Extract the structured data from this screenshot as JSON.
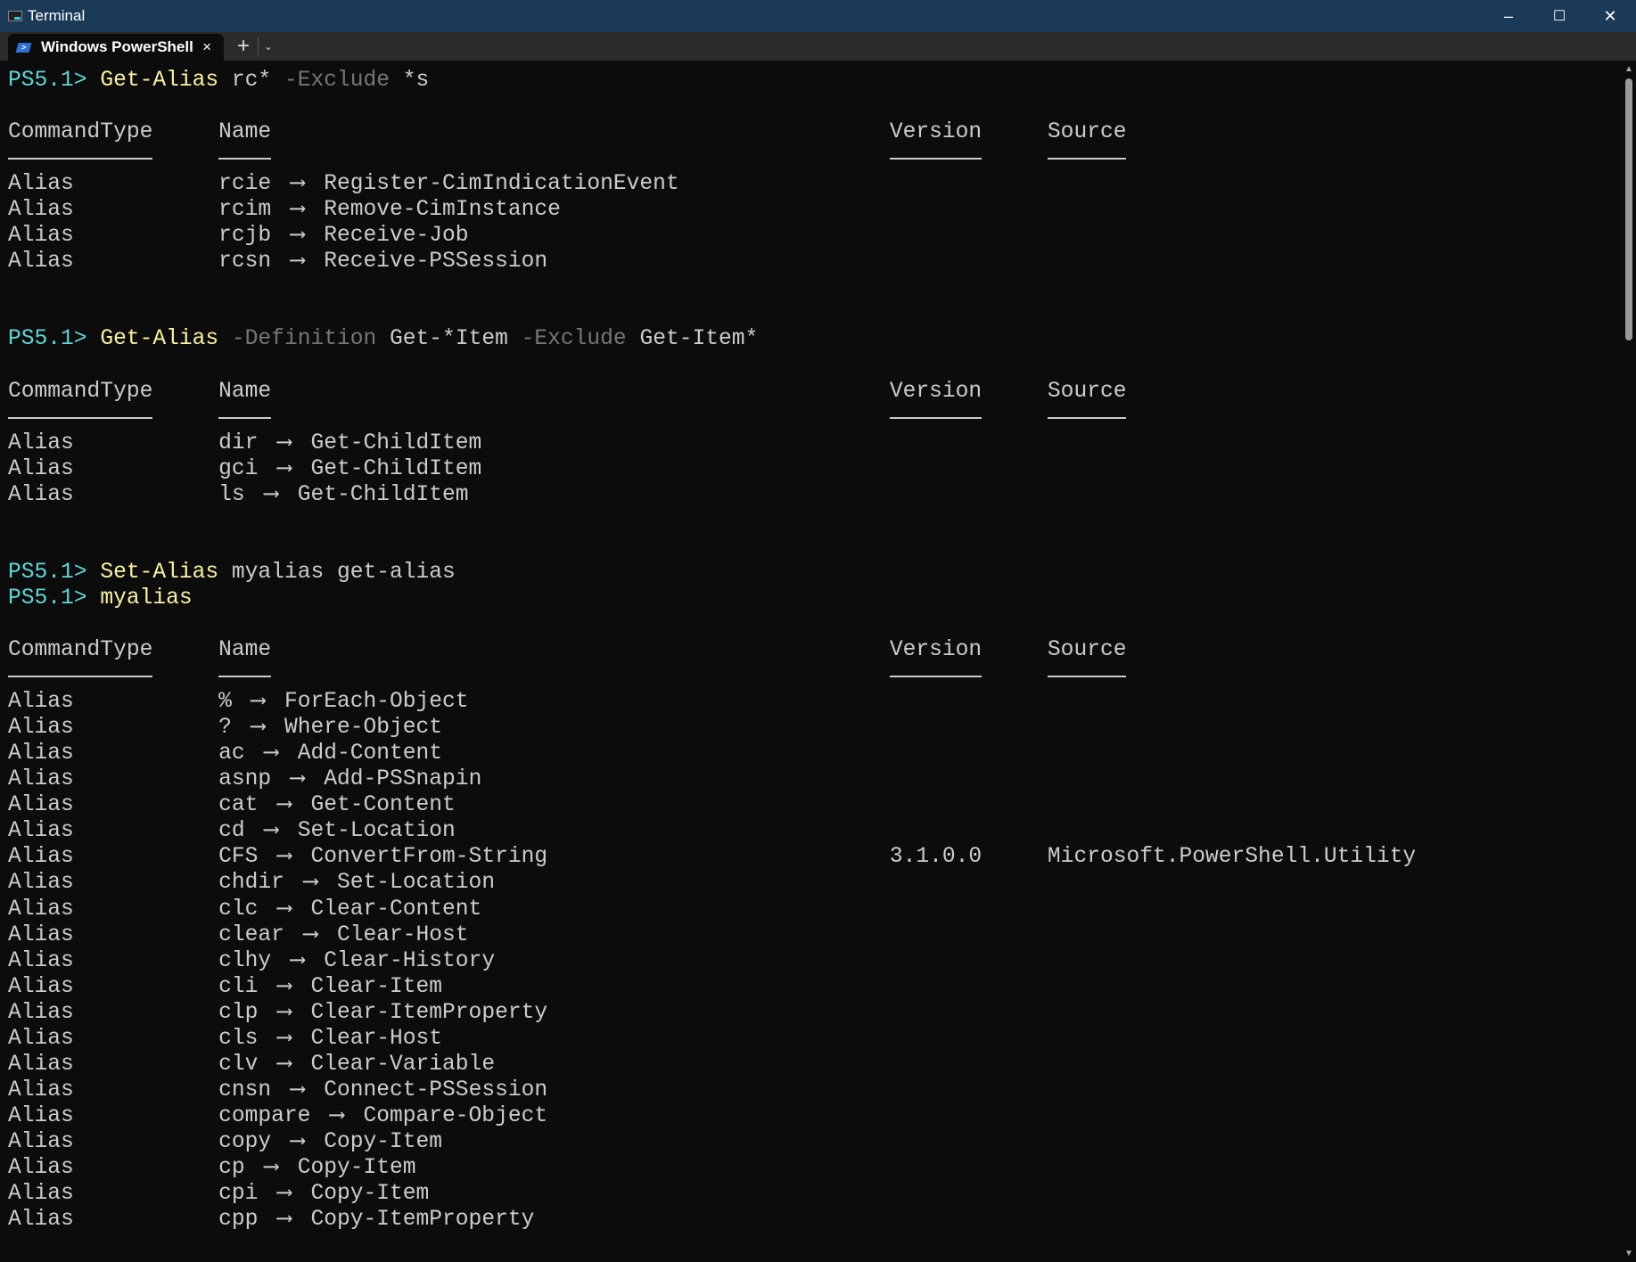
{
  "window": {
    "title": "Terminal",
    "minimize": "–",
    "maximize": "☐",
    "close": "✕"
  },
  "tabs": [
    {
      "label": "Windows PowerShell",
      "close": "×"
    }
  ],
  "new_tab": "+",
  "dropdown": "⌄",
  "prompt": "PS5.1> ",
  "headers": {
    "type": "CommandType",
    "name": "Name",
    "version": "Version",
    "source": "Source"
  },
  "blocks": [
    {
      "commands": [
        {
          "tokens": [
            {
              "t": "Get-Alias",
              "k": "cmd"
            },
            {
              "t": " rc* ",
              "k": "txt"
            },
            {
              "t": "-Exclude",
              "k": "par"
            },
            {
              "t": " *s",
              "k": "txt"
            }
          ]
        }
      ],
      "rows": [
        {
          "type": "Alias",
          "alias": "rcie",
          "def": "Register-CimIndicationEvent"
        },
        {
          "type": "Alias",
          "alias": "rcim",
          "def": "Remove-CimInstance"
        },
        {
          "type": "Alias",
          "alias": "rcjb",
          "def": "Receive-Job"
        },
        {
          "type": "Alias",
          "alias": "rcsn",
          "def": "Receive-PSSession"
        }
      ]
    },
    {
      "commands": [
        {
          "tokens": [
            {
              "t": "Get-Alias",
              "k": "cmd"
            },
            {
              "t": " ",
              "k": "txt"
            },
            {
              "t": "-Definition",
              "k": "par"
            },
            {
              "t": " Get-*Item ",
              "k": "txt"
            },
            {
              "t": "-Exclude",
              "k": "par"
            },
            {
              "t": " Get-Item*",
              "k": "txt"
            }
          ]
        }
      ],
      "rows": [
        {
          "type": "Alias",
          "alias": "dir",
          "def": "Get-ChildItem"
        },
        {
          "type": "Alias",
          "alias": "gci",
          "def": "Get-ChildItem"
        },
        {
          "type": "Alias",
          "alias": "ls",
          "def": "Get-ChildItem"
        }
      ]
    },
    {
      "commands": [
        {
          "tokens": [
            {
              "t": "Set-Alias",
              "k": "cmd"
            },
            {
              "t": " myalias get-alias",
              "k": "txt"
            }
          ]
        },
        {
          "tokens": [
            {
              "t": "myalias",
              "k": "cmd"
            }
          ]
        }
      ],
      "rows": [
        {
          "type": "Alias",
          "alias": "%",
          "def": "ForEach-Object"
        },
        {
          "type": "Alias",
          "alias": "?",
          "def": "Where-Object"
        },
        {
          "type": "Alias",
          "alias": "ac",
          "def": "Add-Content"
        },
        {
          "type": "Alias",
          "alias": "asnp",
          "def": "Add-PSSnapin"
        },
        {
          "type": "Alias",
          "alias": "cat",
          "def": "Get-Content"
        },
        {
          "type": "Alias",
          "alias": "cd",
          "def": "Set-Location"
        },
        {
          "type": "Alias",
          "alias": "CFS",
          "def": "ConvertFrom-String",
          "version": "3.1.0.0",
          "source": "Microsoft.PowerShell.Utility"
        },
        {
          "type": "Alias",
          "alias": "chdir",
          "def": "Set-Location"
        },
        {
          "type": "Alias",
          "alias": "clc",
          "def": "Clear-Content"
        },
        {
          "type": "Alias",
          "alias": "clear",
          "def": "Clear-Host"
        },
        {
          "type": "Alias",
          "alias": "clhy",
          "def": "Clear-History"
        },
        {
          "type": "Alias",
          "alias": "cli",
          "def": "Clear-Item"
        },
        {
          "type": "Alias",
          "alias": "clp",
          "def": "Clear-ItemProperty"
        },
        {
          "type": "Alias",
          "alias": "cls",
          "def": "Clear-Host"
        },
        {
          "type": "Alias",
          "alias": "clv",
          "def": "Clear-Variable"
        },
        {
          "type": "Alias",
          "alias": "cnsn",
          "def": "Connect-PSSession"
        },
        {
          "type": "Alias",
          "alias": "compare",
          "def": "Compare-Object"
        },
        {
          "type": "Alias",
          "alias": "copy",
          "def": "Copy-Item"
        },
        {
          "type": "Alias",
          "alias": "cp",
          "def": "Copy-Item"
        },
        {
          "type": "Alias",
          "alias": "cpi",
          "def": "Copy-Item"
        },
        {
          "type": "Alias",
          "alias": "cpp",
          "def": "Copy-ItemProperty"
        }
      ]
    }
  ]
}
